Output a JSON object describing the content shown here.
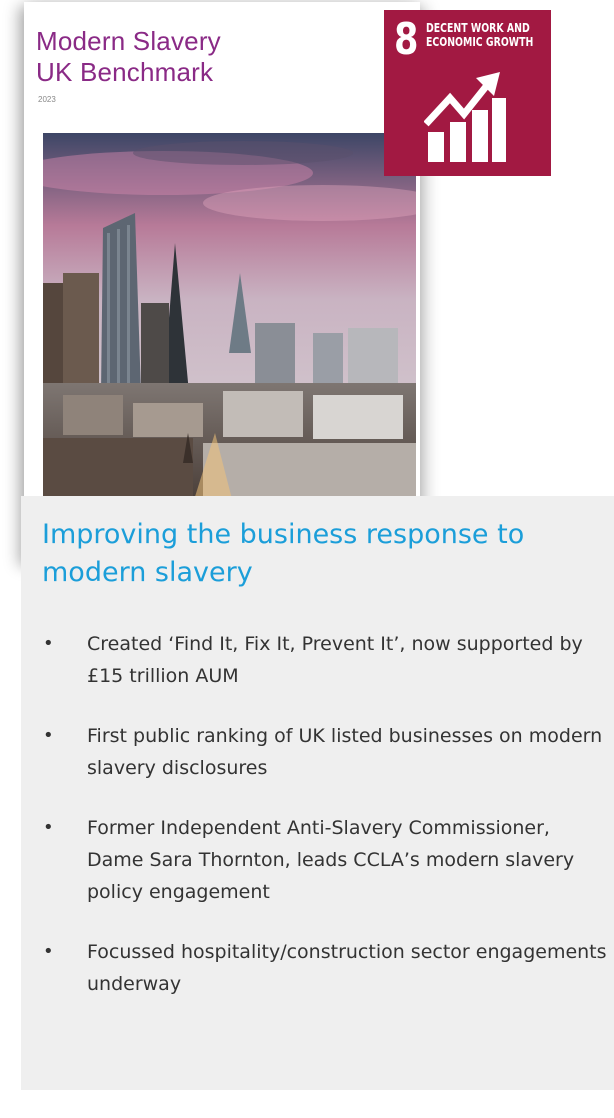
{
  "cover": {
    "title_lines": [
      "Modern Slavery",
      "UK Benchmark"
    ],
    "year": "2023",
    "photo_alt": "City skyline photograph"
  },
  "sdg": {
    "number": "8",
    "label_lines": [
      "DECENT WORK AND",
      "ECONOMIC GROWTH"
    ],
    "icon": "growth-chart-icon",
    "color": "#a21942"
  },
  "panel": {
    "title": "Improving the business response to modern slavery",
    "bullet_symbol": "•",
    "bullets": [
      "Created ‘Find It, Fix It, Prevent It’, now supported by £15 trillion AUM",
      "First public ranking of UK listed businesses on modern slavery disclosures",
      "Former Independent Anti-Slavery Commissioner, Dame Sara Thornton, leads CCLA’s modern slavery policy engagement",
      "Focussed hospitality/construction sector engagements underway"
    ]
  },
  "colors": {
    "cover_title": "#8a2a86",
    "panel_title": "#1b9ed9",
    "panel_bg": "#efefef",
    "body_text": "#333333"
  }
}
